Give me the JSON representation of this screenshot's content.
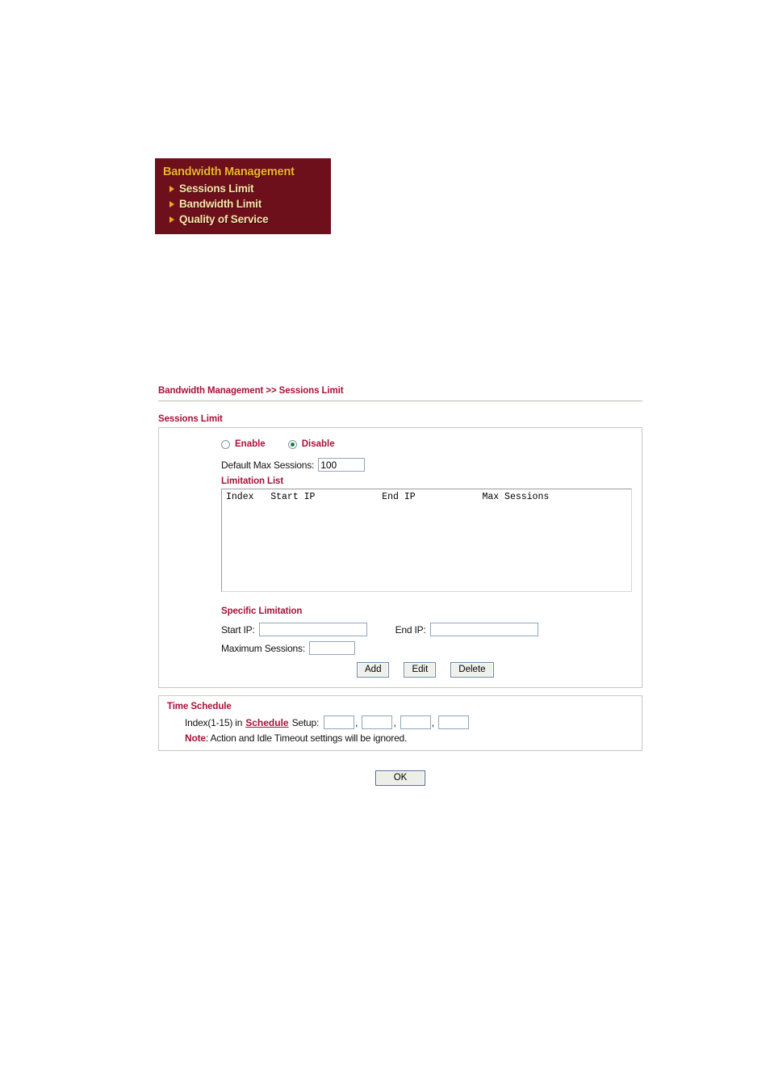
{
  "nav": {
    "title": "Bandwidth Management",
    "items": [
      {
        "label": "Sessions Limit"
      },
      {
        "label": "Bandwidth Limit"
      },
      {
        "label": "Quality of Service"
      }
    ]
  },
  "page": {
    "breadcrumb": "Bandwidth Management >> Sessions Limit",
    "section_title": "Sessions Limit"
  },
  "sessions_limit": {
    "enable_label": "Enable",
    "disable_label": "Disable",
    "selected": "Disable",
    "default_max_sessions_label": "Default Max Sessions:",
    "default_max_sessions_value": "100",
    "limitation_list_label": "Limitation List",
    "list_columns_line": "Index   Start IP            End IP            Max Sessions",
    "list_rows": []
  },
  "specific_limitation": {
    "title": "Specific Limitation",
    "start_ip_label": "Start IP:",
    "start_ip_value": "",
    "end_ip_label": "End IP:",
    "end_ip_value": "",
    "maximum_sessions_label": "Maximum Sessions:",
    "maximum_sessions_value": "",
    "buttons": [
      {
        "label": "Add"
      },
      {
        "label": "Edit"
      },
      {
        "label": "Delete"
      }
    ]
  },
  "time_schedule": {
    "title": "Time Schedule",
    "index_prefix": "Index(1-15) in",
    "schedule_link": "Schedule",
    "index_suffix": "Setup:",
    "index_values": [
      "",
      "",
      "",
      ""
    ],
    "separator": ",",
    "note_word": "Note",
    "note_text": ": Action and Idle Timeout settings will be ignored."
  },
  "footer": {
    "ok_label": "OK"
  },
  "colors": {
    "nav_background": "#6e0f1c",
    "nav_title": "#f3b32a",
    "nav_item": "#f6e6a8",
    "nav_arrow": "#f3a91f",
    "accent_red": "#a6123a",
    "panel_border": "#c9c8bd",
    "radio_selected": "#1f7a3d"
  }
}
